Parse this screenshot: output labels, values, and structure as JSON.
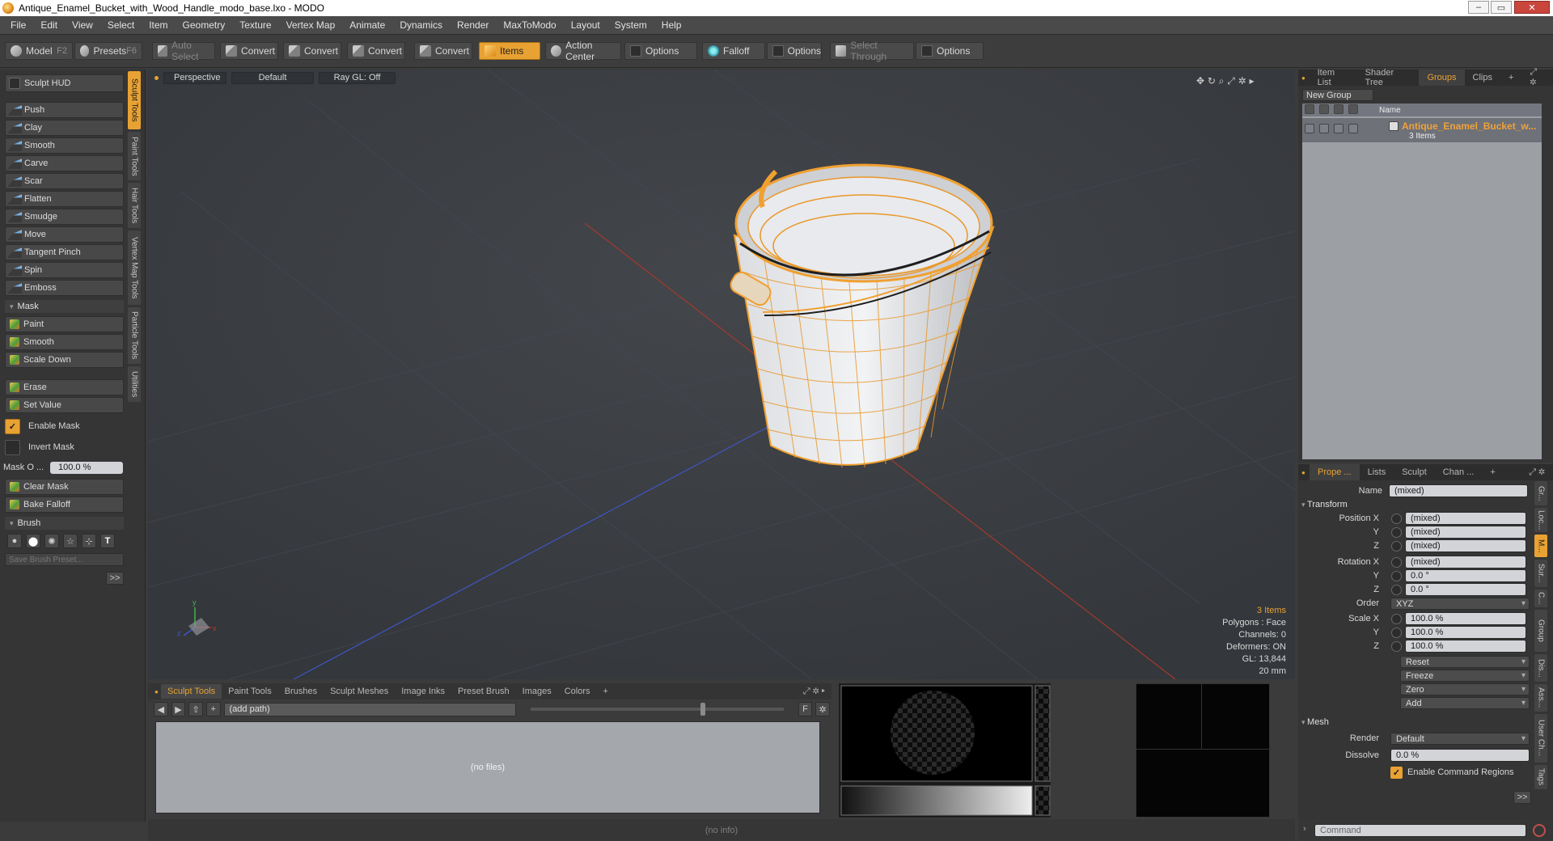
{
  "window": {
    "title": "Antique_Enamel_Bucket_with_Wood_Handle_modo_base.lxo - MODO"
  },
  "menu": [
    "File",
    "Edit",
    "View",
    "Select",
    "Item",
    "Geometry",
    "Texture",
    "Vertex Map",
    "Animate",
    "Dynamics",
    "Render",
    "MaxToModo",
    "Layout",
    "System",
    "Help"
  ],
  "toolbar": {
    "model": "Model",
    "model_key": "F2",
    "presets": "Presets",
    "presets_key": "F6",
    "auto_select": "Auto Select",
    "convert": "Convert",
    "items": "Items",
    "action_center": "Action Center",
    "options": "Options",
    "falloff": "Falloff",
    "select_through": "Select Through"
  },
  "left": {
    "hud": "Sculpt HUD",
    "tools": [
      "Push",
      "Clay",
      "Smooth",
      "Carve",
      "Scar",
      "Flatten",
      "Smudge",
      "Move",
      "Tangent Pinch",
      "Spin",
      "Emboss"
    ],
    "mask_section": "Mask",
    "mask_tools": [
      "Paint",
      "Smooth",
      "Scale Down"
    ],
    "erase": "Erase",
    "set_value": "Set Value",
    "enable_mask": "Enable Mask",
    "invert_mask": "Invert Mask",
    "mask_opacity_label": "Mask O ...",
    "mask_opacity_value": "100.0 %",
    "clear_mask": "Clear Mask",
    "bake_falloff": "Bake Falloff",
    "brush_section": "Brush",
    "brush_preset_placeholder": "Save Brush Preset...",
    "more": ">>",
    "vtabs": [
      "Sculpt Tools",
      "Paint Tools",
      "Hair Tools",
      "Vertex Map Tools",
      "Particle Tools",
      "Utilities"
    ]
  },
  "viewport": {
    "view": "Perspective",
    "style": "Default",
    "raygl": "Ray GL: Off",
    "info": {
      "items": "3 Items",
      "polygons": "Polygons : Face",
      "channels": "Channels: 0",
      "deformers": "Deformers: ON",
      "gl": "GL: 13,844",
      "scale": "20 mm"
    }
  },
  "browser": {
    "tabs": [
      "Sculpt Tools",
      "Paint Tools",
      "Brushes",
      "Sculpt Meshes",
      "Image Inks",
      "Preset Brush",
      "Images",
      "Colors"
    ],
    "path": "(add path)",
    "empty": "(no files)",
    "status": "(no info)"
  },
  "right_top": {
    "tabs": [
      "Item List",
      "Shader Tree",
      "Groups",
      "Clips"
    ],
    "new_group": "New Group",
    "name_header": "Name",
    "group_name": "Antique_Enamel_Bucket_w...",
    "group_count": "3 Items"
  },
  "properties": {
    "tabs": [
      "Prope ...",
      "Lists",
      "Sculpt",
      "Chan ..."
    ],
    "name_label": "Name",
    "name_value": "(mixed)",
    "transform": "Transform",
    "pos_label": "Position X",
    "rot_label": "Rotation X",
    "scale_label": "Scale X",
    "y": "Y",
    "z": "Z",
    "pos": [
      "(mixed)",
      "(mixed)",
      "(mixed)"
    ],
    "rot": [
      "(mixed)",
      "0.0 °",
      "0.0 °"
    ],
    "order_label": "Order",
    "order": "XYZ",
    "scale": [
      "100.0 %",
      "100.0 %",
      "100.0 %"
    ],
    "reset": "Reset",
    "freeze": "Freeze",
    "zero": "Zero",
    "add": "Add",
    "mesh": "Mesh",
    "render_label": "Render",
    "render": "Default",
    "dissolve_label": "Dissolve",
    "dissolve": "0.0 %",
    "enable_cmd_regions": "Enable Command Regions",
    "more": ">>",
    "side_tabs": [
      "Gr...",
      "Loc...",
      "M...",
      "Sur...",
      "C...",
      "Group",
      "Dis...",
      "Ass...",
      "User Ch...",
      "Tags"
    ]
  },
  "command": {
    "placeholder": "Command"
  },
  "colors": {
    "accent": "#e8a233",
    "viewport": "#3a3d42",
    "wire": "#f0a030"
  }
}
